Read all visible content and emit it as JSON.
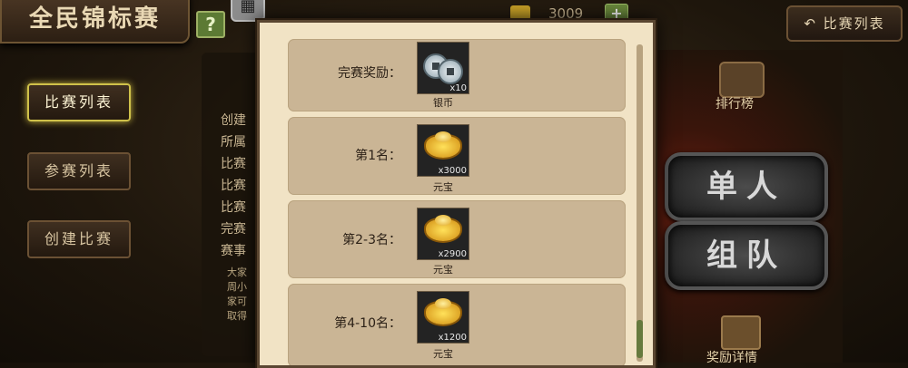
{
  "header": {
    "title": "全民锦标赛",
    "help_label": "?",
    "currency_value": "3009",
    "currency_plus": "+",
    "back_label": "比赛列表"
  },
  "sidebar": {
    "items": [
      {
        "label": "比赛列表",
        "active": true
      },
      {
        "label": "参赛列表",
        "active": false
      },
      {
        "label": "创建比赛",
        "active": false
      }
    ]
  },
  "info_panel": {
    "lines": [
      "创建",
      "所属",
      "比赛",
      "比赛",
      "比赛",
      "完赛",
      "赛事"
    ],
    "small_lines": [
      "大家",
      "周小",
      "家可",
      "取得"
    ]
  },
  "right_panel": {
    "rank_label": "排行榜",
    "single_label": "单人",
    "team_label": "组队",
    "reward_label": "奖励详情"
  },
  "rewards": [
    {
      "label": "完赛奖励：",
      "item": "银币",
      "qty": "x10",
      "kind": "silver"
    },
    {
      "label": "第1名：",
      "item": "元宝",
      "qty": "x3000",
      "kind": "ingot"
    },
    {
      "label": "第2-3名：",
      "item": "元宝",
      "qty": "x2900",
      "kind": "ingot"
    },
    {
      "label": "第4-10名：",
      "item": "元宝",
      "qty": "x1200",
      "kind": "ingot"
    }
  ],
  "colors": {
    "panel_bg": "#f1e3c5",
    "row_bg": "#cab595",
    "active_border": "#cfc14a"
  }
}
